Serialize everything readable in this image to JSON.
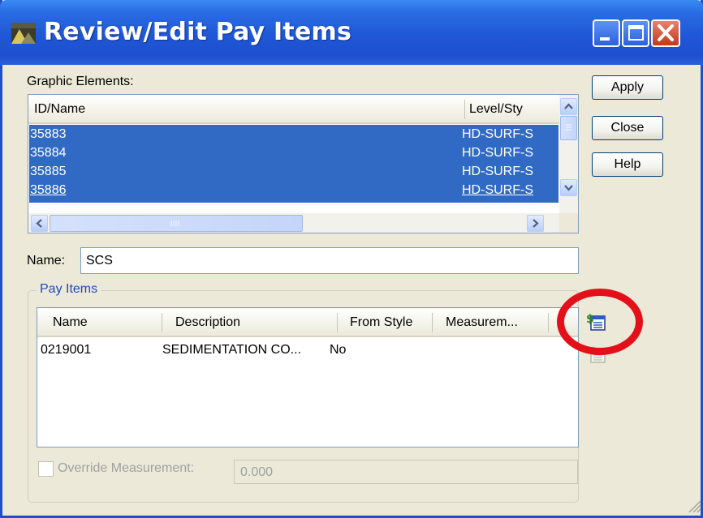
{
  "window": {
    "title": "Review/Edit Pay Items"
  },
  "graphic_elements": {
    "label": "Graphic Elements:",
    "columns": [
      "ID/Name",
      "Level/Sty"
    ],
    "rows": [
      {
        "id": "35883",
        "level": "HD-SURF-S"
      },
      {
        "id": "35884",
        "level": "HD-SURF-S"
      },
      {
        "id": "35885",
        "level": "HD-SURF-S"
      },
      {
        "id": "35886",
        "level": "HD-SURF-S"
      }
    ]
  },
  "buttons": {
    "apply": "Apply",
    "close": "Close",
    "help": "Help"
  },
  "name_field": {
    "label": "Name:",
    "value": "SCS"
  },
  "pay_items": {
    "group_label": "Pay Items",
    "columns": [
      "Name",
      "Description",
      "From Style",
      "Measurem..."
    ],
    "rows": [
      {
        "name": "0219001",
        "description": "SEDIMENTATION CO...",
        "from_style": "No",
        "measurement": ""
      }
    ]
  },
  "override": {
    "label": "Override Measurement:",
    "value": "0.000",
    "checked": false
  },
  "icons": {
    "add_pay_item": "add-pay-item-icon",
    "remove_pay_item": "remove-pay-item-icon"
  },
  "colors": {
    "title_bar": "#1E4FCF",
    "selection": "#316AC5",
    "highlight_circle": "#E3101A"
  }
}
